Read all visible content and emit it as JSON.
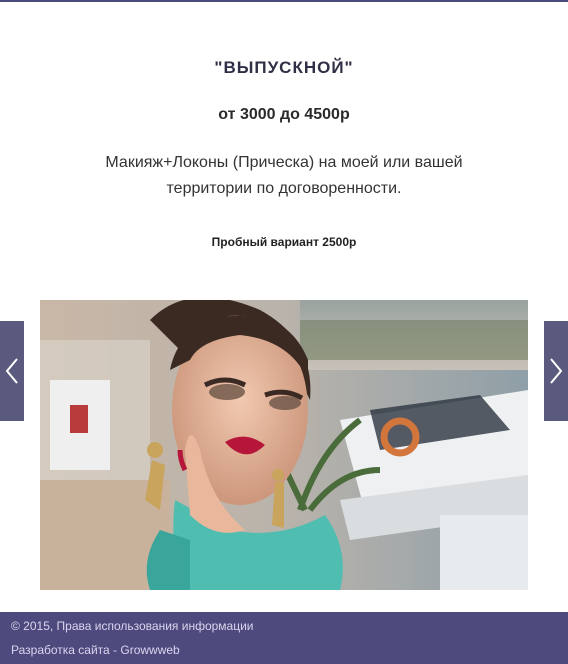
{
  "content": {
    "title": "\"ВЫПУСКНОЙ\"",
    "price": "от 3000 до 4500р",
    "description": "Макияж+Локоны (Прическа) на моей или вашей территории по договоренности.",
    "trial": "Пробный вариант 2500р"
  },
  "slider": {
    "image_description": "photo-woman-makeup-yacht",
    "prev_icon": "chevron-left-icon",
    "next_icon": "chevron-right-icon"
  },
  "footer": {
    "copyright": "© 2015, Права использования информации",
    "developer": "Разработка сайта - Growwweb"
  },
  "colors": {
    "accent": "#4e4a7e",
    "arrow_bg": "#5a5a7e"
  }
}
